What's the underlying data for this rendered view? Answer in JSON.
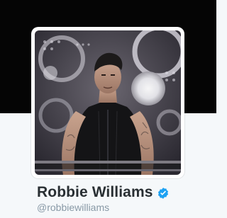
{
  "profile": {
    "display_name": "Robbie Williams",
    "screen_name": "@robbiewilliams",
    "verified": true,
    "avatar_alt": "Robbie Williams profile photo"
  },
  "icons": {
    "verified": "verified-badge-icon"
  },
  "colors": {
    "banner": "#050505",
    "page_background": "#f5f8fa",
    "name_text": "#292f33",
    "handle_text": "#8899a6",
    "verified_blue": "#1da1f2"
  }
}
